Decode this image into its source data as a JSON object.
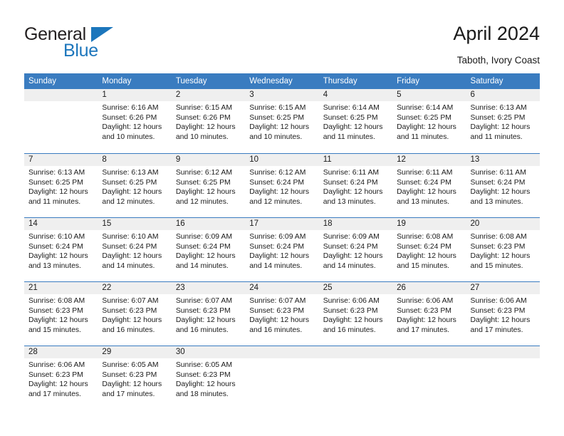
{
  "brand": {
    "name_top": "General",
    "name_bottom": "Blue",
    "accent_color": "#1c76bc",
    "triangle_icon": "blue-triangle-logo-mark"
  },
  "header": {
    "title": "April 2024",
    "subtitle": "Taboth, Ivory Coast"
  },
  "calendar": {
    "header_bg": "#3a7cc0",
    "daynum_band_bg": "#efefef",
    "weekday_headers": [
      "Sunday",
      "Monday",
      "Tuesday",
      "Wednesday",
      "Thursday",
      "Friday",
      "Saturday"
    ],
    "weeks": [
      [
        {
          "day": "",
          "lines": []
        },
        {
          "day": "1",
          "lines": [
            "Sunrise: 6:16 AM",
            "Sunset: 6:26 PM",
            "Daylight: 12 hours",
            "and 10 minutes."
          ]
        },
        {
          "day": "2",
          "lines": [
            "Sunrise: 6:15 AM",
            "Sunset: 6:26 PM",
            "Daylight: 12 hours",
            "and 10 minutes."
          ]
        },
        {
          "day": "3",
          "lines": [
            "Sunrise: 6:15 AM",
            "Sunset: 6:25 PM",
            "Daylight: 12 hours",
            "and 10 minutes."
          ]
        },
        {
          "day": "4",
          "lines": [
            "Sunrise: 6:14 AM",
            "Sunset: 6:25 PM",
            "Daylight: 12 hours",
            "and 11 minutes."
          ]
        },
        {
          "day": "5",
          "lines": [
            "Sunrise: 6:14 AM",
            "Sunset: 6:25 PM",
            "Daylight: 12 hours",
            "and 11 minutes."
          ]
        },
        {
          "day": "6",
          "lines": [
            "Sunrise: 6:13 AM",
            "Sunset: 6:25 PM",
            "Daylight: 12 hours",
            "and 11 minutes."
          ]
        }
      ],
      [
        {
          "day": "7",
          "lines": [
            "Sunrise: 6:13 AM",
            "Sunset: 6:25 PM",
            "Daylight: 12 hours",
            "and 11 minutes."
          ]
        },
        {
          "day": "8",
          "lines": [
            "Sunrise: 6:13 AM",
            "Sunset: 6:25 PM",
            "Daylight: 12 hours",
            "and 12 minutes."
          ]
        },
        {
          "day": "9",
          "lines": [
            "Sunrise: 6:12 AM",
            "Sunset: 6:25 PM",
            "Daylight: 12 hours",
            "and 12 minutes."
          ]
        },
        {
          "day": "10",
          "lines": [
            "Sunrise: 6:12 AM",
            "Sunset: 6:24 PM",
            "Daylight: 12 hours",
            "and 12 minutes."
          ]
        },
        {
          "day": "11",
          "lines": [
            "Sunrise: 6:11 AM",
            "Sunset: 6:24 PM",
            "Daylight: 12 hours",
            "and 13 minutes."
          ]
        },
        {
          "day": "12",
          "lines": [
            "Sunrise: 6:11 AM",
            "Sunset: 6:24 PM",
            "Daylight: 12 hours",
            "and 13 minutes."
          ]
        },
        {
          "day": "13",
          "lines": [
            "Sunrise: 6:11 AM",
            "Sunset: 6:24 PM",
            "Daylight: 12 hours",
            "and 13 minutes."
          ]
        }
      ],
      [
        {
          "day": "14",
          "lines": [
            "Sunrise: 6:10 AM",
            "Sunset: 6:24 PM",
            "Daylight: 12 hours",
            "and 13 minutes."
          ]
        },
        {
          "day": "15",
          "lines": [
            "Sunrise: 6:10 AM",
            "Sunset: 6:24 PM",
            "Daylight: 12 hours",
            "and 14 minutes."
          ]
        },
        {
          "day": "16",
          "lines": [
            "Sunrise: 6:09 AM",
            "Sunset: 6:24 PM",
            "Daylight: 12 hours",
            "and 14 minutes."
          ]
        },
        {
          "day": "17",
          "lines": [
            "Sunrise: 6:09 AM",
            "Sunset: 6:24 PM",
            "Daylight: 12 hours",
            "and 14 minutes."
          ]
        },
        {
          "day": "18",
          "lines": [
            "Sunrise: 6:09 AM",
            "Sunset: 6:24 PM",
            "Daylight: 12 hours",
            "and 14 minutes."
          ]
        },
        {
          "day": "19",
          "lines": [
            "Sunrise: 6:08 AM",
            "Sunset: 6:24 PM",
            "Daylight: 12 hours",
            "and 15 minutes."
          ]
        },
        {
          "day": "20",
          "lines": [
            "Sunrise: 6:08 AM",
            "Sunset: 6:23 PM",
            "Daylight: 12 hours",
            "and 15 minutes."
          ]
        }
      ],
      [
        {
          "day": "21",
          "lines": [
            "Sunrise: 6:08 AM",
            "Sunset: 6:23 PM",
            "Daylight: 12 hours",
            "and 15 minutes."
          ]
        },
        {
          "day": "22",
          "lines": [
            "Sunrise: 6:07 AM",
            "Sunset: 6:23 PM",
            "Daylight: 12 hours",
            "and 16 minutes."
          ]
        },
        {
          "day": "23",
          "lines": [
            "Sunrise: 6:07 AM",
            "Sunset: 6:23 PM",
            "Daylight: 12 hours",
            "and 16 minutes."
          ]
        },
        {
          "day": "24",
          "lines": [
            "Sunrise: 6:07 AM",
            "Sunset: 6:23 PM",
            "Daylight: 12 hours",
            "and 16 minutes."
          ]
        },
        {
          "day": "25",
          "lines": [
            "Sunrise: 6:06 AM",
            "Sunset: 6:23 PM",
            "Daylight: 12 hours",
            "and 16 minutes."
          ]
        },
        {
          "day": "26",
          "lines": [
            "Sunrise: 6:06 AM",
            "Sunset: 6:23 PM",
            "Daylight: 12 hours",
            "and 17 minutes."
          ]
        },
        {
          "day": "27",
          "lines": [
            "Sunrise: 6:06 AM",
            "Sunset: 6:23 PM",
            "Daylight: 12 hours",
            "and 17 minutes."
          ]
        }
      ],
      [
        {
          "day": "28",
          "lines": [
            "Sunrise: 6:06 AM",
            "Sunset: 6:23 PM",
            "Daylight: 12 hours",
            "and 17 minutes."
          ]
        },
        {
          "day": "29",
          "lines": [
            "Sunrise: 6:05 AM",
            "Sunset: 6:23 PM",
            "Daylight: 12 hours",
            "and 17 minutes."
          ]
        },
        {
          "day": "30",
          "lines": [
            "Sunrise: 6:05 AM",
            "Sunset: 6:23 PM",
            "Daylight: 12 hours",
            "and 18 minutes."
          ]
        },
        {
          "day": "",
          "lines": []
        },
        {
          "day": "",
          "lines": []
        },
        {
          "day": "",
          "lines": []
        },
        {
          "day": "",
          "lines": []
        }
      ]
    ]
  }
}
